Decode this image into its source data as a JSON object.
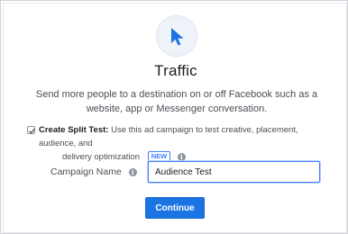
{
  "objective": {
    "icon": "cursor-arrow-icon",
    "title": "Traffic",
    "description": "Send more people to a destination on or off Facebook such as a website, app or Messenger conversation."
  },
  "split_test": {
    "checked": true,
    "label": "Create Split Test:",
    "description_line1": "Use this ad campaign to test creative, placement, audience, and",
    "description_line2": "delivery optimization",
    "badge": "NEW",
    "info_icon": "info-icon"
  },
  "campaign_name": {
    "label": "Campaign Name",
    "info_icon": "info-icon",
    "value": "Audience Test"
  },
  "actions": {
    "continue_label": "Continue"
  },
  "colors": {
    "accent": "#1b74e4",
    "focus_border": "#4080ff"
  }
}
